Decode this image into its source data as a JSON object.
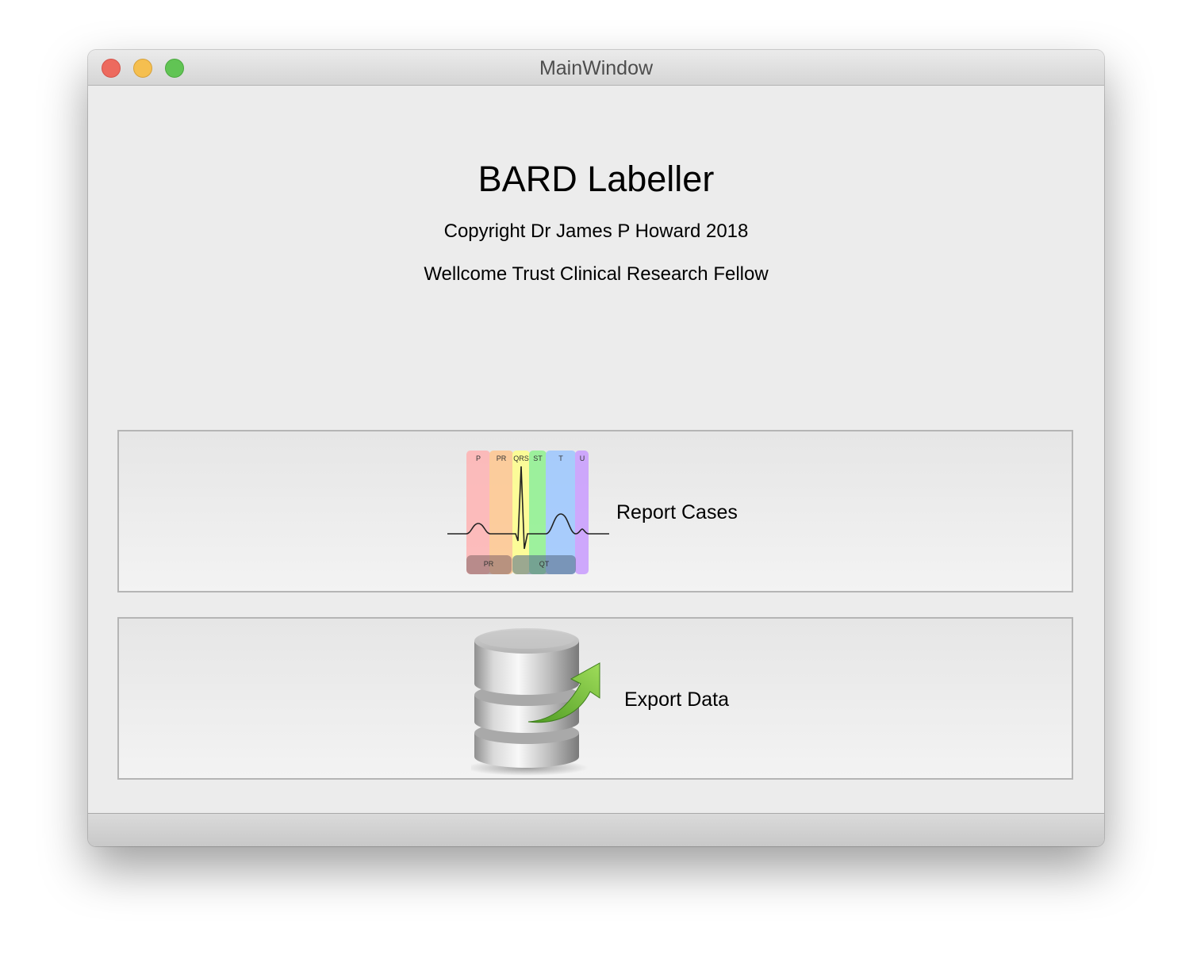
{
  "window": {
    "title": "MainWindow"
  },
  "header": {
    "app_title": "BARD Labeller",
    "copyright": "Copyright Dr James P Howard 2018",
    "subtitle": "Wellcome Trust Clinical Research Fellow"
  },
  "actions": {
    "report_label": "Report Cases",
    "export_label": "Export Data"
  },
  "ecg_icon": {
    "segments": {
      "p": "P",
      "pr": "PR",
      "qrs": "QRS",
      "st": "ST",
      "t": "T",
      "u": "U",
      "pr_interval": "PR",
      "qt_interval": "QT"
    },
    "colors": {
      "p": "#ffb3b3",
      "pr": "#ffc78f",
      "qrs": "#ffff8a",
      "st": "#8ff28f",
      "t": "#9cc7ff",
      "u": "#c99cff"
    }
  },
  "icons": {
    "report": "ecg-waveform-icon",
    "export": "database-export-icon"
  }
}
